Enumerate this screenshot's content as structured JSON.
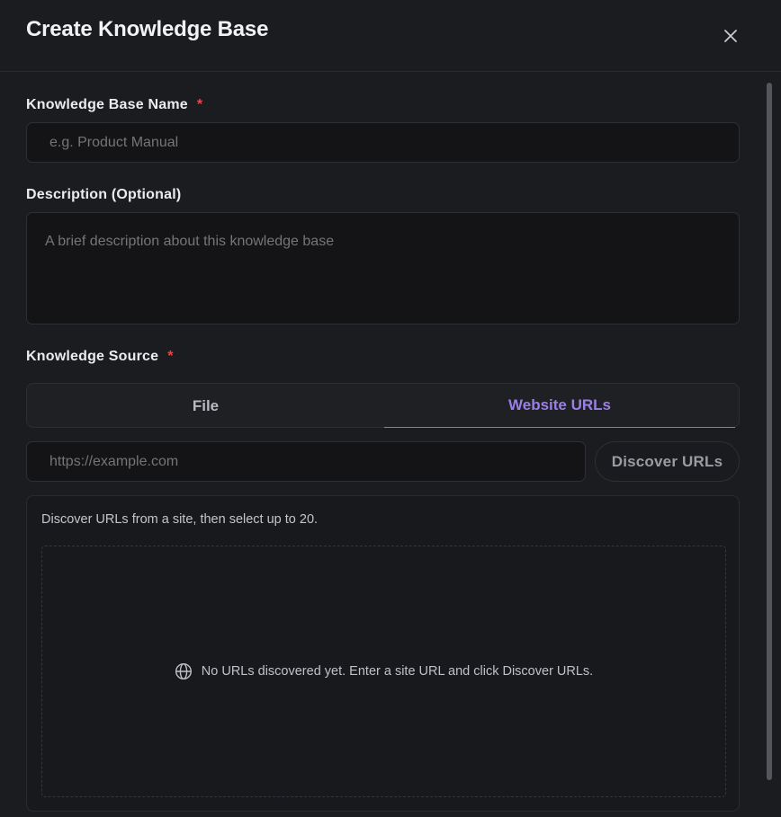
{
  "dialog": {
    "title": "Create Knowledge Base"
  },
  "fields": {
    "name": {
      "label": "Knowledge Base Name",
      "required_mark": "*",
      "value": "",
      "placeholder": "e.g. Product Manual"
    },
    "description": {
      "label": "Description (Optional)",
      "value": "",
      "placeholder": "A brief description about this knowledge base"
    },
    "source": {
      "label": "Knowledge Source",
      "required_mark": "*",
      "tabs": [
        {
          "label": "File",
          "active": false
        },
        {
          "label": "Website URLs",
          "active": true
        }
      ]
    },
    "url": {
      "value": "",
      "placeholder": "https://example.com",
      "button_label": "Discover URLs"
    }
  },
  "discovery": {
    "hint": "Discover URLs from a site, then select up to 20.",
    "empty_message": "No URLs discovered yet. Enter a site URL and click Discover URLs.",
    "empty_icon": "globe-icon"
  },
  "colors": {
    "accent": "#8d6fe0",
    "required": "#e5484d",
    "background": "#1b1c20"
  }
}
